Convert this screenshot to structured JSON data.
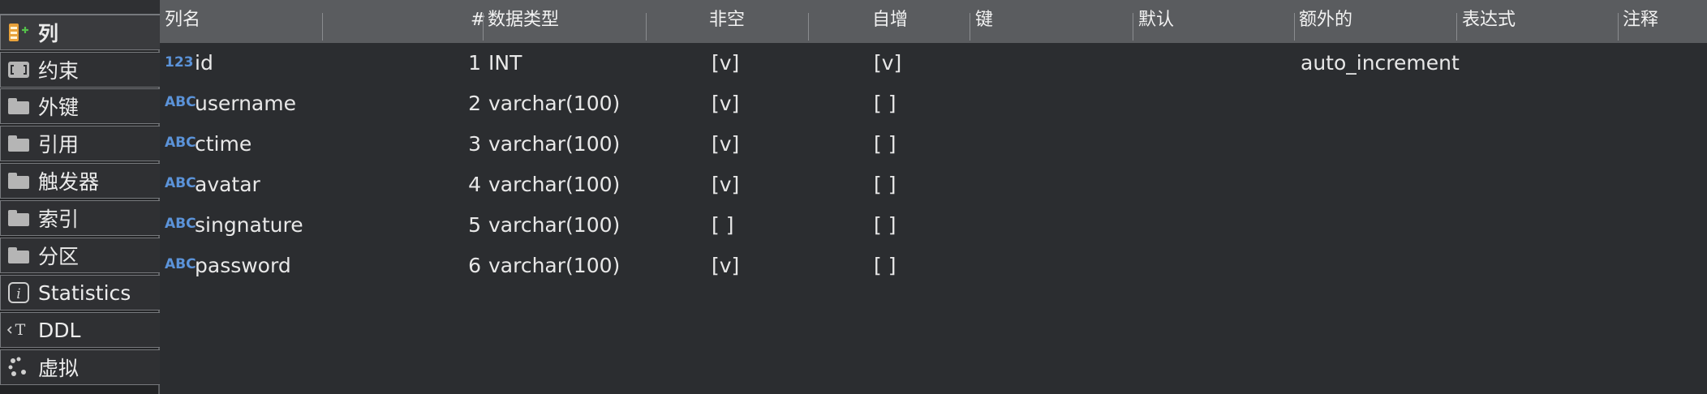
{
  "sidebar": {
    "items": [
      {
        "label": "列",
        "icon": "columns-add-icon"
      },
      {
        "label": "约束",
        "icon": "constraint-icon"
      },
      {
        "label": "外键",
        "icon": "folder-icon"
      },
      {
        "label": "引用",
        "icon": "folder-icon"
      },
      {
        "label": "触发器",
        "icon": "folder-icon"
      },
      {
        "label": "索引",
        "icon": "folder-icon"
      },
      {
        "label": "分区",
        "icon": "folder-icon"
      },
      {
        "label": "Statistics",
        "icon": "info-icon"
      },
      {
        "label": "DDL",
        "icon": "ddl-icon"
      },
      {
        "label": "虚拟",
        "icon": "virtual-icon"
      }
    ]
  },
  "table": {
    "headers": {
      "column_name": "列名",
      "ordinal": "#",
      "data_type": "数据类型",
      "not_null": "非空",
      "auto_increment": "自增",
      "key": "键",
      "default": "默认",
      "extra": "额外的",
      "expression": "表达式",
      "comment": "注释"
    },
    "rows": [
      {
        "type_icon": "123",
        "name": "id",
        "ordinal": "1",
        "data_type": "INT",
        "not_null": "[v]",
        "auto_increment": "[v]",
        "extra": "auto_increment"
      },
      {
        "type_icon": "ABC",
        "name": "username",
        "ordinal": "2",
        "data_type": "varchar(100)",
        "not_null": "[v]",
        "auto_increment": "[ ]",
        "extra": ""
      },
      {
        "type_icon": "ABC",
        "name": "ctime",
        "ordinal": "3",
        "data_type": "varchar(100)",
        "not_null": "[v]",
        "auto_increment": "[ ]",
        "extra": ""
      },
      {
        "type_icon": "ABC",
        "name": "avatar",
        "ordinal": "4",
        "data_type": "varchar(100)",
        "not_null": "[v]",
        "auto_increment": "[ ]",
        "extra": ""
      },
      {
        "type_icon": "ABC",
        "name": "singnature",
        "ordinal": "5",
        "data_type": "varchar(100)",
        "not_null": "[ ]",
        "auto_increment": "[ ]",
        "extra": ""
      },
      {
        "type_icon": "ABC",
        "name": "password",
        "ordinal": "6",
        "data_type": "varchar(100)",
        "not_null": "[v]",
        "auto_increment": "[ ]",
        "extra": ""
      }
    ]
  },
  "colors": {
    "type_icon": "#5b93d9",
    "header_bg": "#5a5c5f",
    "grid_bg": "#2b2d30"
  }
}
